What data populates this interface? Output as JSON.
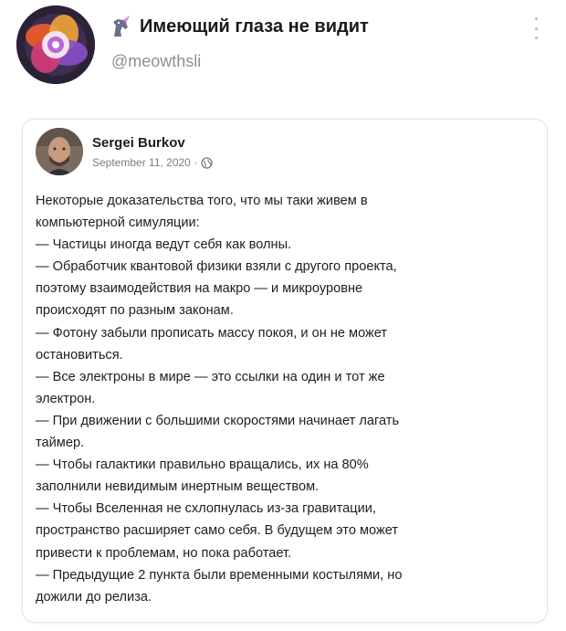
{
  "channel": {
    "title": "Имеющий глаза не видит",
    "handle": "@meowthsli",
    "avatar_icon": "swirl-logo",
    "title_icon": "unicorn-icon"
  },
  "post": {
    "author": "Sergei Burkov",
    "date": "September 11, 2020 ·",
    "privacy_icon": "globe-icon",
    "lines": [
      "Некоторые доказательства того, что мы таки живем в",
      "компьютерной симуляции:",
      "— Частицы иногда ведут себя как волны.",
      "— Обработчик квантовой физики взяли с другого проекта,",
      "поэтому взаимодействия на макро — и микроуровне",
      "происходят по разным законам.",
      "— Фотону забыли прописать массу покоя, и он не может",
      "остановиться.",
      "— Все электроны в мире — это ссылки на один и тот же",
      "электрон.",
      "— При движении с большими скоростями начинает лагать",
      "таймер.",
      "— Чтобы галактики правильно вращались, их на 80%",
      "заполнили невидимым инертным веществом.",
      "— Чтобы Вселенная не схлопнулась из-за гравитации,",
      "пространство расширяет само себя. В будущем это может",
      "привести к проблемам, но пока работает.",
      "— Предыдущие 2 пункта были временными костылями, но",
      "дожили до релиза."
    ]
  }
}
